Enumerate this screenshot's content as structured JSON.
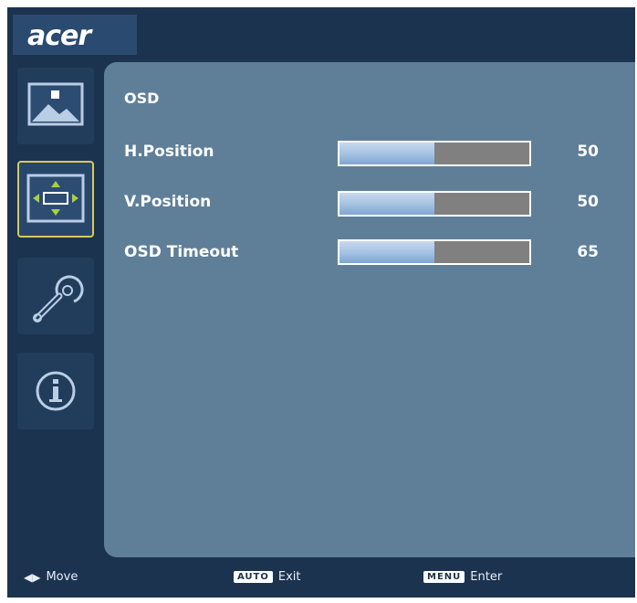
{
  "brand": {
    "logo_text": "acer"
  },
  "sidebar": {
    "items": [
      {
        "icon": "picture-icon",
        "selected": false
      },
      {
        "icon": "position-icon",
        "selected": true
      },
      {
        "icon": "wrench-icon",
        "selected": false
      },
      {
        "icon": "info-icon",
        "selected": false
      }
    ]
  },
  "osd": {
    "title": "OSD",
    "settings": [
      {
        "label": "H.Position",
        "value": "50",
        "level": 0.5
      },
      {
        "label": "V.Position",
        "value": "50",
        "level": 0.5
      },
      {
        "label": "OSD Timeout",
        "value": "65",
        "level": 0.5
      }
    ]
  },
  "footer": {
    "move_label": "Move",
    "exit_key": "AUTO",
    "exit_label": "Exit",
    "enter_key": "MENU",
    "enter_label": "Enter"
  },
  "colors": {
    "background": "#1c3350",
    "panel": "#5f7f99",
    "selected_border": "#d6c95c"
  }
}
